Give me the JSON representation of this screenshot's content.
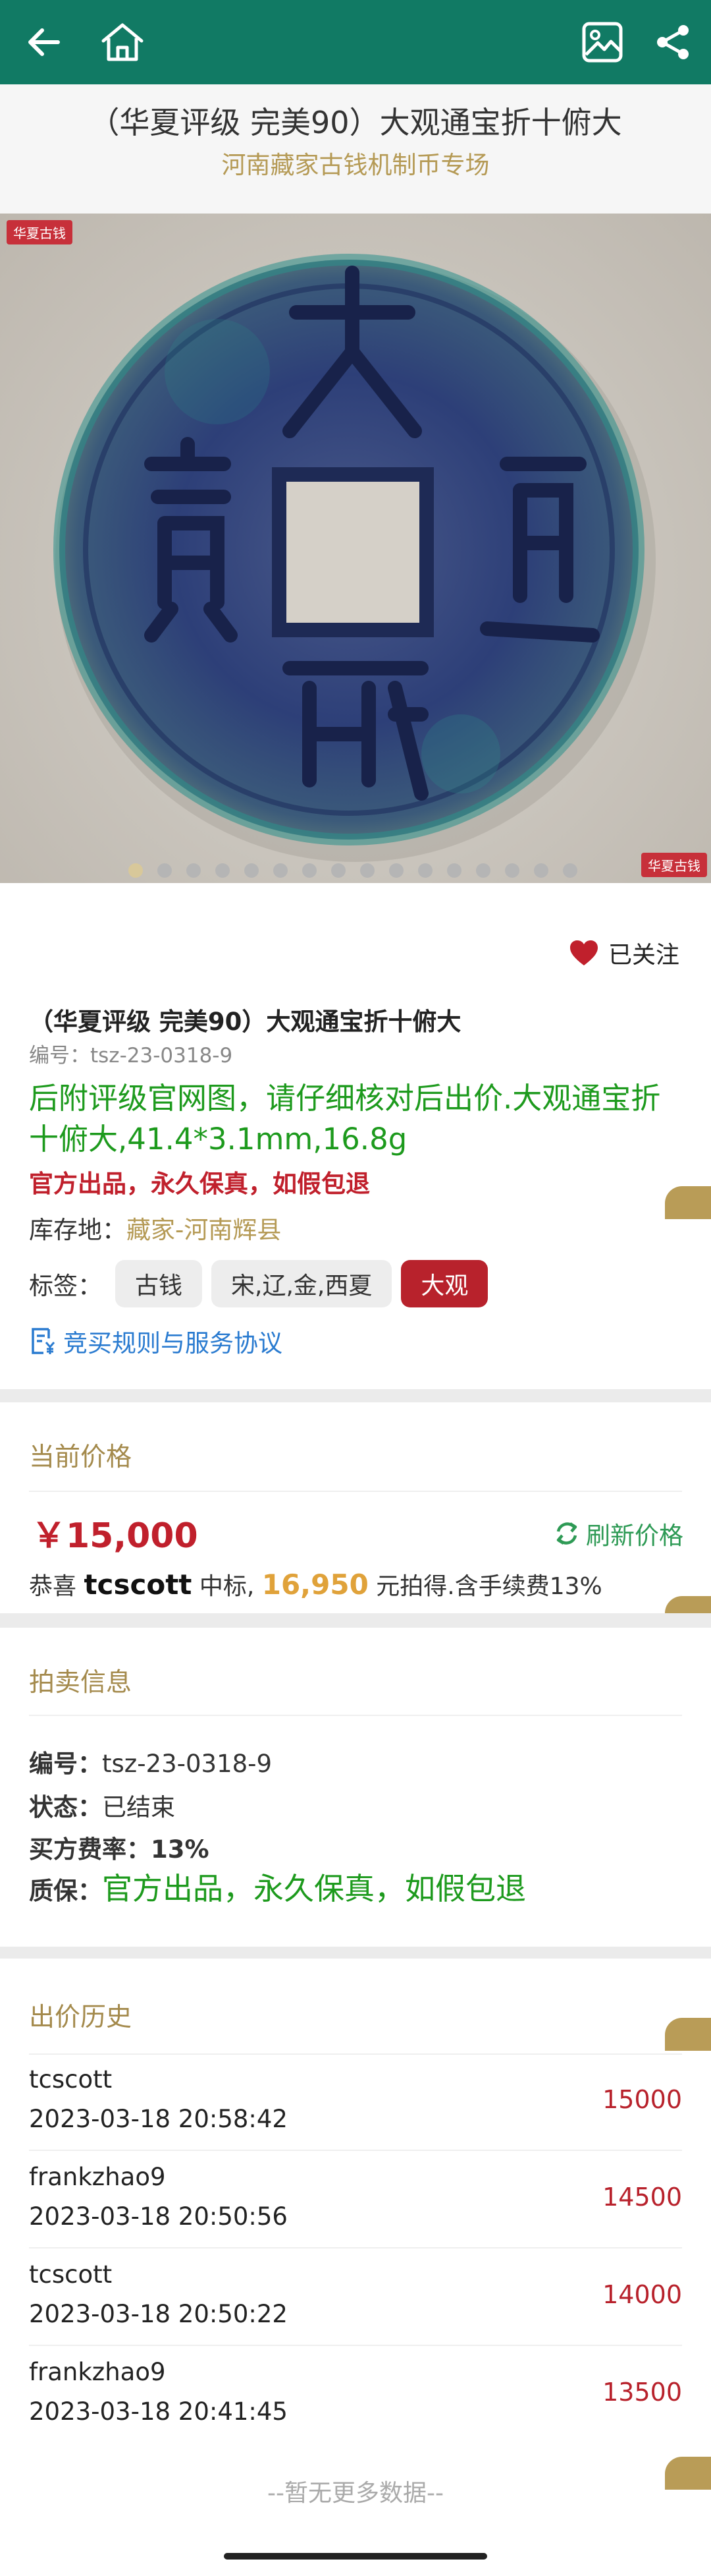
{
  "topbar": {
    "icons": [
      "back-arrow-icon",
      "home-icon",
      "image-gallery-icon",
      "share-icon"
    ],
    "color": "#117a64"
  },
  "header": {
    "title": "（华夏评级 完美90）大观通宝折十俯大",
    "subtitle": "河南藏家古钱机制币专场"
  },
  "gallery": {
    "watermark": "华夏古钱",
    "slide_count": 16,
    "active_index": 0
  },
  "product": {
    "follow_label": "已关注",
    "title": "（华夏评级 完美90）大观通宝折十俯大",
    "code": "编号：tsz-23-0318-9",
    "description": "后附评级官网图，请仔细核对后出价.大观通宝折十俯大,41.4*3.1mm,16.8g",
    "guarantee": "官方出品，永久保真，如假包退",
    "store_label": "库存地：",
    "store_location": "藏家-河南辉县",
    "tags_label": "标签：",
    "tags": [
      "古钱",
      "宋,辽,金,西夏",
      "大观"
    ],
    "rules_link": "竞买规则与服务协议"
  },
  "price": {
    "heading": "当前价格",
    "current": "￥15,000",
    "refresh_label": "刷新价格",
    "winner_prefix": "恭喜",
    "winner_user": "tcscott",
    "winner_mid": "中标,",
    "winner_amount": "16,950",
    "winner_suffix": "元拍得.含手续费13%"
  },
  "auction_info": {
    "heading": "拍卖信息",
    "code_label": "编号：",
    "code_value": "tsz-23-0318-9",
    "status_label": "状态：",
    "status_value": "已结束",
    "fee_label": "买方费率：",
    "fee_value": "13%",
    "warranty_label": "质保：",
    "warranty_value": "官方出品，永久保真，如假包退"
  },
  "bid_history": {
    "heading": "出价历史",
    "bids": [
      {
        "user": "tcscott",
        "time": "2023-03-18 20:58:42",
        "amount": "15000"
      },
      {
        "user": "frankzhao9",
        "time": "2023-03-18 20:50:56",
        "amount": "14500"
      },
      {
        "user": "tcscott",
        "time": "2023-03-18 20:50:22",
        "amount": "14000"
      },
      {
        "user": "frankzhao9",
        "time": "2023-03-18 20:41:45",
        "amount": "13500"
      }
    ],
    "no_more": "--暂无更多数据--"
  }
}
